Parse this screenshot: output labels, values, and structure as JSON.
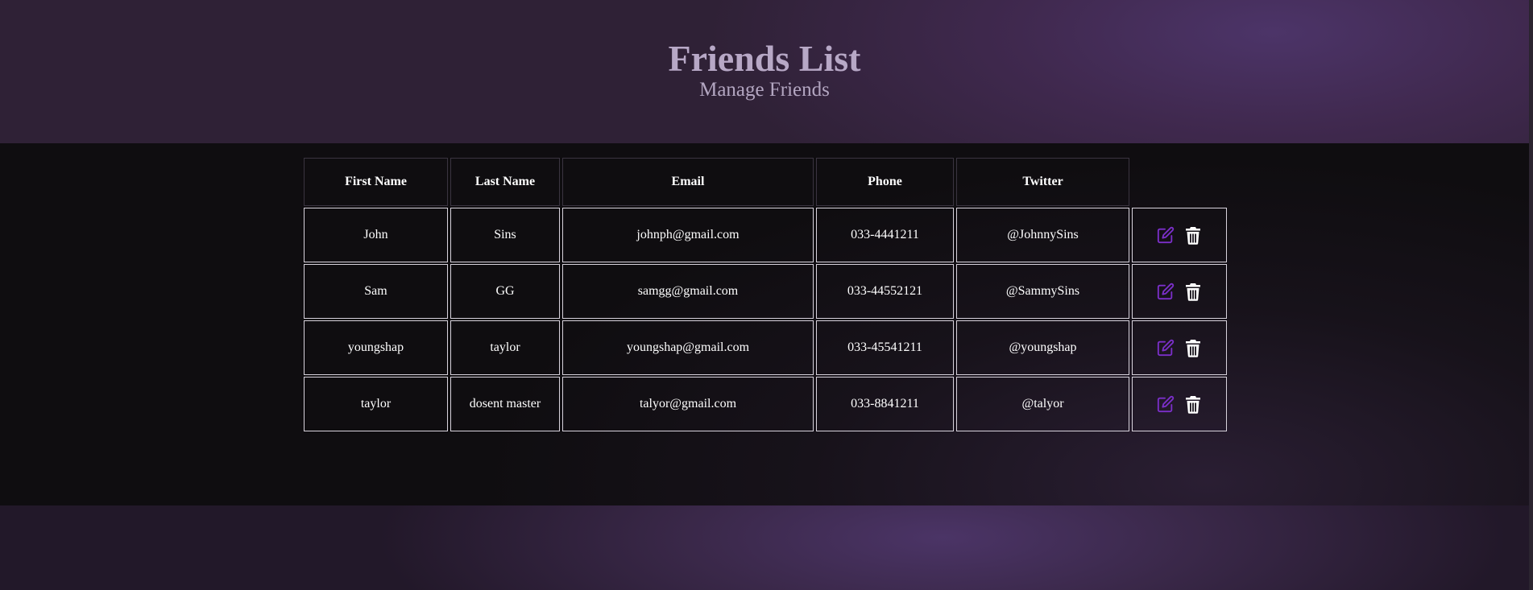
{
  "header": {
    "title": "Friends List",
    "subtitle": "Manage Friends"
  },
  "table": {
    "columns": [
      "First Name",
      "Last Name",
      "Email",
      "Phone",
      "Twitter"
    ],
    "rows": [
      {
        "first": "John",
        "last": "Sins",
        "email": "johnph@gmail.com",
        "phone": "033-4441211",
        "twitter": "@JohnnySins"
      },
      {
        "first": "Sam",
        "last": "GG",
        "email": "samgg@gmail.com",
        "phone": "033-44552121",
        "twitter": "@SammySins"
      },
      {
        "first": "youngshap",
        "last": "taylor",
        "email": "youngshap@gmail.com",
        "phone": "033-45541211",
        "twitter": "@youngshap"
      },
      {
        "first": "taylor",
        "last": "dosent master",
        "email": "talyor@gmail.com",
        "phone": "033-8841211",
        "twitter": "@talyor"
      }
    ],
    "row_actions": {
      "edit_icon": "edit-icon",
      "delete_icon": "trash-icon"
    }
  },
  "colors": {
    "edit_icon": "#7b2fc9",
    "delete_icon": "#ffffff",
    "title": "#b7a8c6"
  }
}
